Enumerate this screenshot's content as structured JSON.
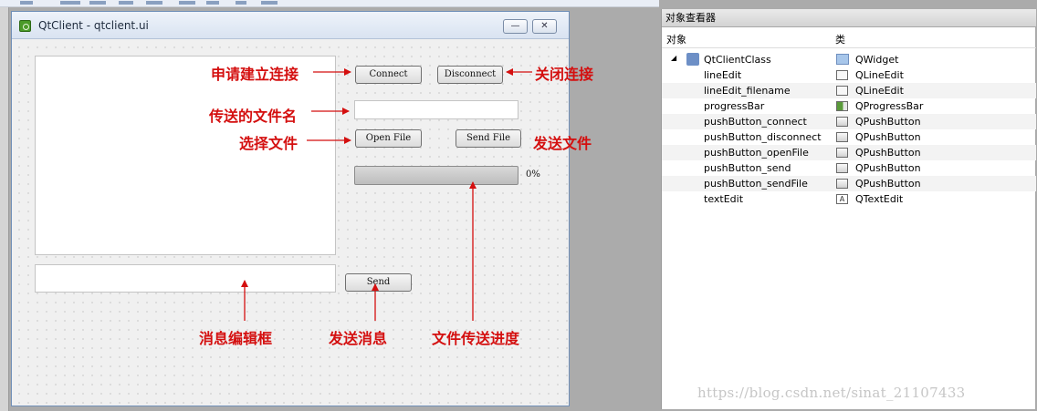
{
  "designer": {
    "title": "QtClient - qtclient.ui",
    "minimize_label": "—",
    "close_label": "✕"
  },
  "form": {
    "connect_label": "Connect",
    "disconnect_label": "Disconnect",
    "open_file_label": "Open File",
    "send_file_label": "Send File",
    "send_label": "Send",
    "filename_value": "",
    "message_value": "",
    "progress": 0,
    "progress_text": "0%"
  },
  "annotations": {
    "request_connect": "申请建立连接",
    "filename": "传送的文件名",
    "choose_file": "选择文件",
    "close_connect": "关闭连接",
    "send_file": "发送文件",
    "message_box": "消息编辑框",
    "send_message": "发送消息",
    "transfer_progress": "文件传送进度"
  },
  "inspector": {
    "title": "对象查看器",
    "col_object": "对象",
    "col_class": "类",
    "root": {
      "name": "QtClientClass",
      "class": "QWidget"
    },
    "items": [
      {
        "name": "lineEdit",
        "class": "QLineEdit",
        "icon": "line-edit-icon"
      },
      {
        "name": "lineEdit_filename",
        "class": "QLineEdit",
        "icon": "line-edit-icon"
      },
      {
        "name": "progressBar",
        "class": "QProgressBar",
        "icon": "progress-bar-icon"
      },
      {
        "name": "pushButton_connect",
        "class": "QPushButton",
        "icon": "push-button-icon"
      },
      {
        "name": "pushButton_disconnect",
        "class": "QPushButton",
        "icon": "push-button-icon"
      },
      {
        "name": "pushButton_openFile",
        "class": "QPushButton",
        "icon": "push-button-icon"
      },
      {
        "name": "pushButton_send",
        "class": "QPushButton",
        "icon": "push-button-icon"
      },
      {
        "name": "pushButton_sendFile",
        "class": "QPushButton",
        "icon": "push-button-icon"
      },
      {
        "name": "textEdit",
        "class": "QTextEdit",
        "icon": "text-edit-icon"
      }
    ]
  },
  "watermark": "https://blog.csdn.net/sinat_21107433",
  "colors": {
    "annotation": "#d40f0f",
    "title_bar": "#d9e3f1"
  }
}
